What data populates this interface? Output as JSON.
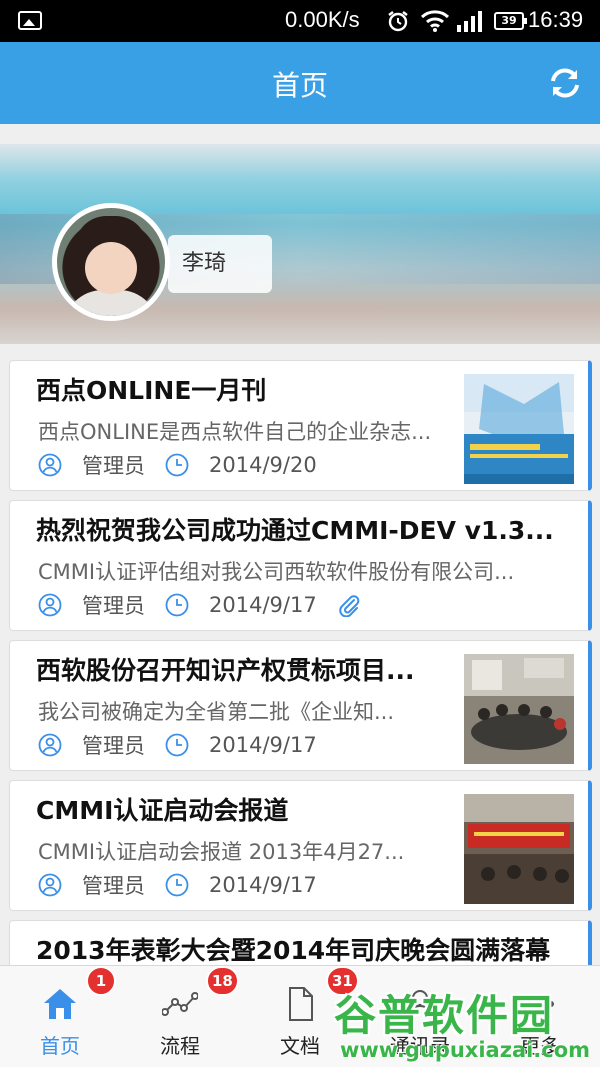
{
  "status_bar": {
    "speed": "0.00K/s",
    "battery": "39",
    "time": "16:39"
  },
  "header": {
    "title": "首页"
  },
  "profile": {
    "name": "李琦"
  },
  "articles": [
    {
      "title": "西点ONLINE一月刊",
      "summary": "西点ONLINE是西点软件自己的企业杂志...",
      "author": "管理员",
      "date": "2014/9/20"
    },
    {
      "title": "热烈祝贺我公司成功通过CMMI-DEV v1.3...",
      "summary": "CMMI认证评估组对我公司西软软件股份有限公司...",
      "author": "管理员",
      "date": "2014/9/17"
    },
    {
      "title": "西软股份召开知识产权贯标项目...",
      "summary": "我公司被确定为全省第二批《企业知...",
      "author": "管理员",
      "date": "2014/9/17"
    },
    {
      "title": "CMMI认证启动会报道",
      "summary": "CMMI认证启动会报道 2013年4月27...",
      "author": "管理员",
      "date": "2014/9/17"
    },
    {
      "title": "2013年表彰大会暨2014年司庆晚会圆满落幕",
      "summary": "",
      "author": "",
      "date": ""
    }
  ],
  "nav": [
    {
      "label": "首页",
      "badge": "1",
      "icon": "home-icon"
    },
    {
      "label": "流程",
      "badge": "18",
      "icon": "workflow-icon"
    },
    {
      "label": "文档",
      "badge": "31",
      "icon": "document-icon"
    },
    {
      "label": "通讯录",
      "badge": "",
      "icon": "contacts-icon"
    },
    {
      "label": "更多",
      "badge": "",
      "icon": "more-icon"
    }
  ],
  "watermark": {
    "line1": "谷普软件园",
    "line2": "www.gupuxiazai.com"
  },
  "colors": {
    "accent": "#3aa0e6",
    "card_border": "#3a8fe8",
    "badge": "#e53030"
  }
}
